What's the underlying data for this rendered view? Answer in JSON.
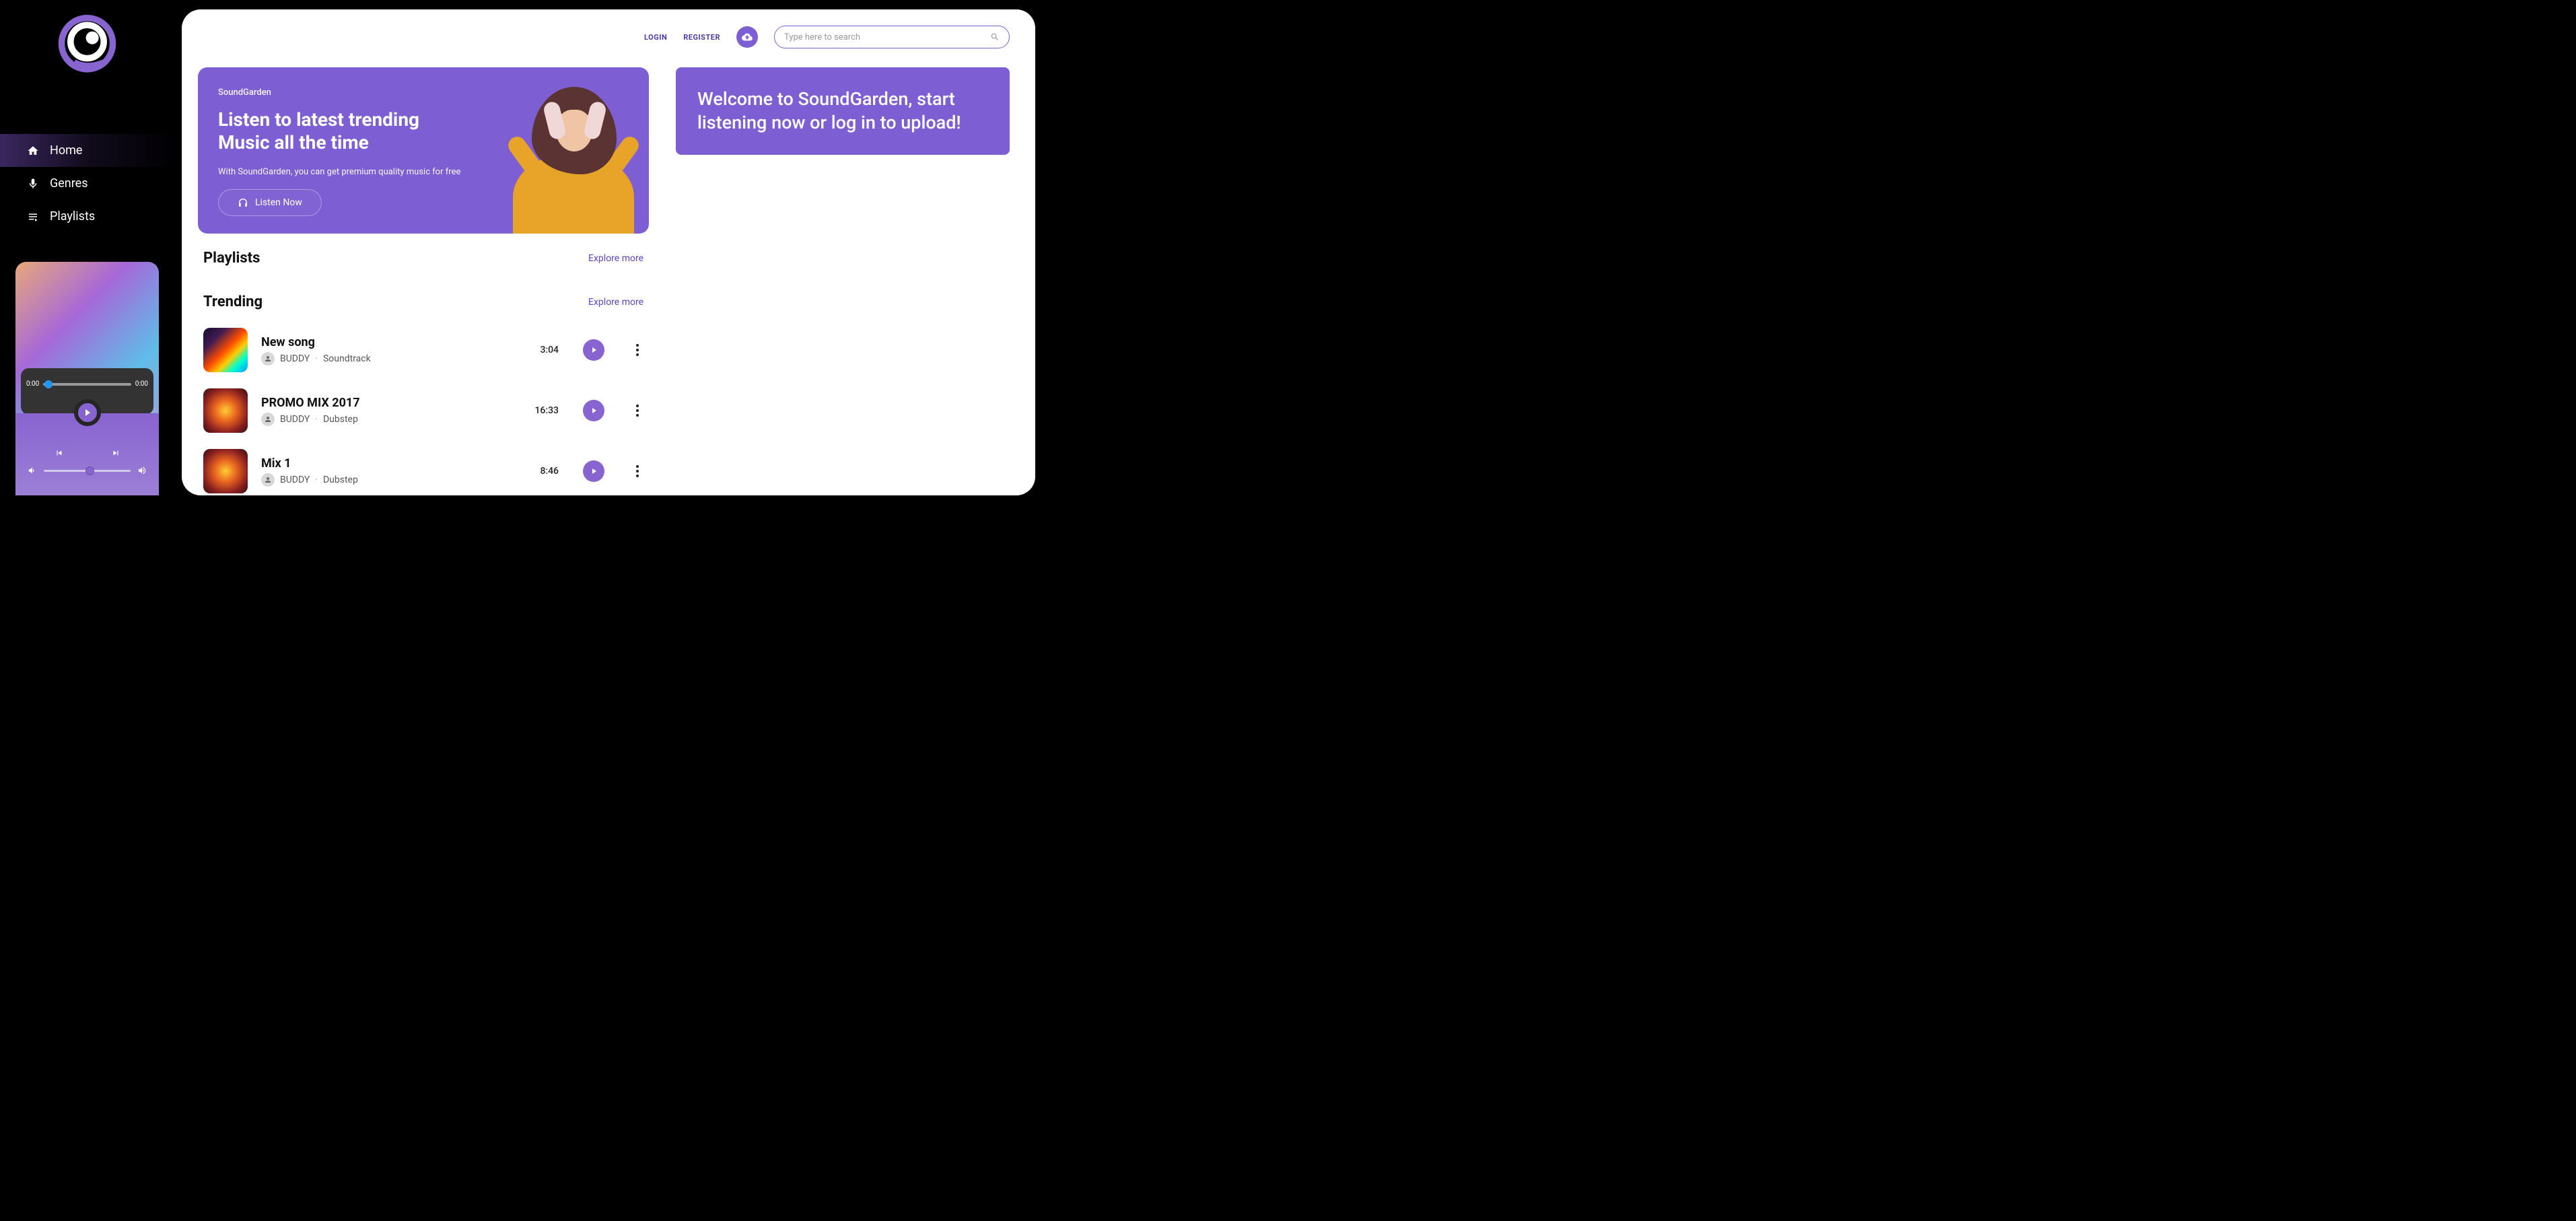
{
  "sidebar": {
    "nav": [
      {
        "label": "Home",
        "icon": "home"
      },
      {
        "label": "Genres",
        "icon": "mic"
      },
      {
        "label": "Playlists",
        "icon": "library"
      }
    ]
  },
  "player": {
    "time_current": "0:00",
    "time_total": "0:00"
  },
  "topbar": {
    "login": "LOGIN",
    "register": "REGISTER",
    "search_placeholder": "Type here to search"
  },
  "hero": {
    "brand": "SoundGarden",
    "title_line1": "Listen to latest trending",
    "title_line2": "Music all the time",
    "subtitle": "With SoundGarden, you can get premium quality music for free",
    "button": "Listen Now"
  },
  "welcome": {
    "text": "Welcome to SoundGarden, start listening now or log in to upload!"
  },
  "sections": {
    "playlists": {
      "title": "Playlists",
      "explore": "Explore more"
    },
    "trending": {
      "title": "Trending",
      "explore": "Explore more"
    }
  },
  "tracks": [
    {
      "title": "New song",
      "artist": "BUDDY",
      "genre": "Soundtrack",
      "duration": "3:04"
    },
    {
      "title": "PROMO MIX 2017",
      "artist": "BUDDY",
      "genre": "Dubstep",
      "duration": "16:33"
    },
    {
      "title": "Mix 1",
      "artist": "BUDDY",
      "genre": "Dubstep",
      "duration": "8:46"
    }
  ],
  "colors": {
    "accent": "#7e5ed3",
    "accent_dark": "#4a3ba8"
  }
}
